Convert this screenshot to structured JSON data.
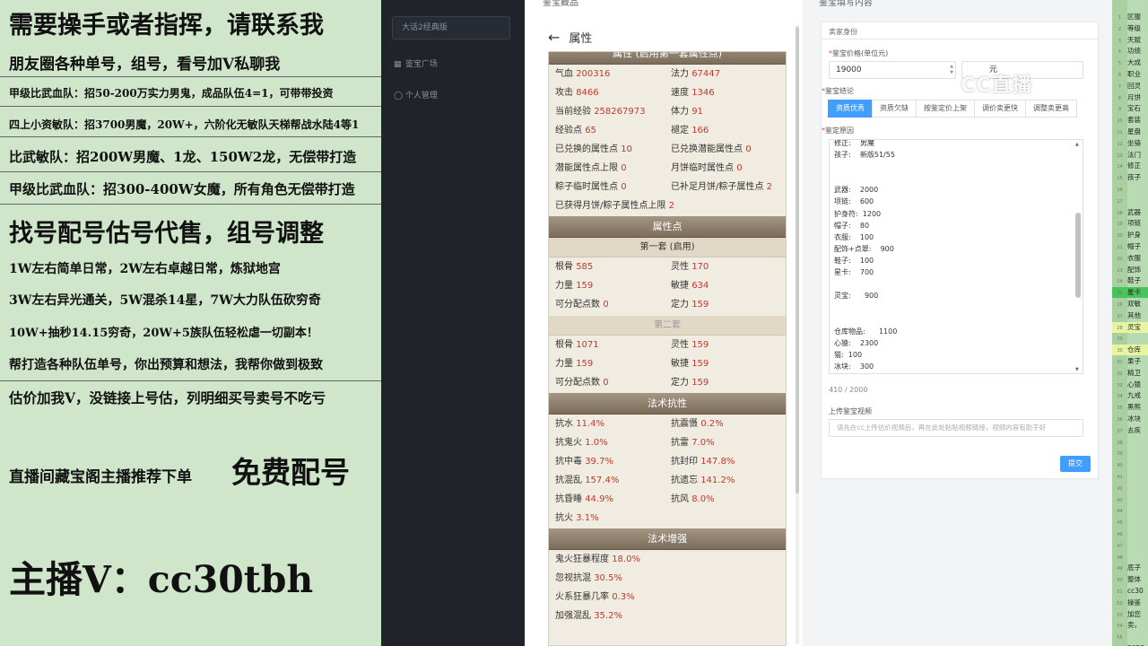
{
  "promo": {
    "lines": [
      "需要操手或者指挥，请联系我",
      "朋友圈各种单号，组号，看号加V私聊我",
      "甲级比武血队：招50-200万实力男鬼，成品队伍4=1，可带带投资",
      "四上小资敏队：招3700男魔，20W+，六阶化无敏队天梯帮战水陆4等1",
      "比武敏队：招200W男魔、1龙、150W2龙，无偿带打造",
      "甲级比武血队：招300-400W女魔，所有角色无偿带打造",
      "找号配号估号代售，组号调整",
      "1W左右简单日常，2W左右卓越日常，炼狱地宫",
      "3W左右异光通关，5W混杀14星，7W大力队伍砍穷奇",
      "10W+抽秒14.15穷奇，20W+5族队伍轻松虐一切副本！",
      "帮打造各种队伍单号，你出预算和想法，我帮你做到极致",
      "估价加我V，没链接上号估，列明细买号卖号不吃亏",
      "直播间藏宝阁主播推荐下单",
      "免费配号",
      "主播V：cc30tbh"
    ]
  },
  "nav": {
    "server_select": "大话2经典版",
    "items": [
      "鉴宝广场",
      "个人管理"
    ]
  },
  "attr_panel": {
    "top_text": "鉴宝藏品",
    "back_label": "属性",
    "section_basic_title": "属性 (启用第一套属性点)",
    "basic_rows": [
      [
        "气血",
        "200316",
        "法力",
        "67447"
      ],
      [
        "攻击",
        "8466",
        "速度",
        "1346"
      ],
      [
        "当前经验",
        "258267973",
        "体力",
        "91"
      ],
      [
        "经验点",
        "65",
        "褪定",
        "166"
      ],
      [
        "已兑换的属性点",
        "10",
        "已兑换潜能属性点",
        "0"
      ],
      [
        "潜能属性点上限",
        "0",
        "月饼临时属性点",
        "0"
      ],
      [
        "粽子临时属性点",
        "0",
        "已补足月饼/粽子属性点",
        "2"
      ]
    ],
    "basic_full_row": [
      "已获得月饼/粽子属性点上限",
      "2"
    ],
    "section_points_title": "属性点",
    "set1_title": "第一套 (启用)",
    "set1_rows": [
      [
        "根骨",
        "585",
        "灵性",
        "170"
      ],
      [
        "力量",
        "159",
        "敏捷",
        "634"
      ],
      [
        "可分配点数",
        "0",
        "定力",
        "159"
      ]
    ],
    "set2_title": "第二套",
    "set2_rows": [
      [
        "根骨",
        "1071",
        "灵性",
        "159"
      ],
      [
        "力量",
        "159",
        "敏捷",
        "159"
      ],
      [
        "可分配点数",
        "0",
        "定力",
        "159"
      ]
    ],
    "section_resist_title": "法术抗性",
    "resist_rows": [
      [
        "抗水",
        "11.4%",
        "抗震慑",
        "0.2%"
      ],
      [
        "抗鬼火",
        "1.0%",
        "抗雷",
        "7.0%"
      ],
      [
        "抗中毒",
        "39.7%",
        "抗封印",
        "147.8%"
      ],
      [
        "抗混乱",
        "157.4%",
        "抗遗忘",
        "141.2%"
      ],
      [
        "抗昏睡",
        "44.9%",
        "抗风",
        "8.0%"
      ]
    ],
    "resist_full_row": [
      "抗火",
      "3.1%"
    ],
    "section_boost_title": "法术增强",
    "boost_rows": [
      [
        "鬼火狂暴程度",
        "18.0%"
      ],
      [
        "忽视抗混",
        "30.5%"
      ],
      [
        "火系狂暴几率",
        "0.3%"
      ],
      [
        "加强混乱",
        "35.2%"
      ]
    ]
  },
  "form": {
    "top_text": "鉴宝填写内容",
    "card_title": "卖家身份",
    "price_label": "鉴宝价格(单位元)",
    "price_value": "19000",
    "unit_value": "元",
    "watermark": "CC直播",
    "conclusion_label": "鉴宝结论",
    "conclusion_tabs": [
      "资质优秀",
      "资质欠缺",
      "按鉴定价上架",
      "调价卖更快",
      "调整卖更高"
    ],
    "conclusion_selected": "资质优秀",
    "reason_label": "鉴定原因",
    "reason_text": "修正:    男魔\n孩子:    新版51/55\n\n\n武器:    2000\n项链:    600\n护身符:  1200\n帽子:    80\n衣服:    100\n配饰+点翠:    900\n鞋子:    100\n星卡:    700\n\n灵宝:      900\n\n\n仓库物品:      1100\n心猿:    2300\n猫:  100\n冰块:    300",
    "count_text": "410 / 2000",
    "video_label": "上传鉴宝视频",
    "video_placeholder": "请先在cc上传估价视频后，再在此处粘贴视频链接，视频内容有助于好",
    "submit_label": "提交"
  },
  "strip": {
    "lines": [
      "区服",
      "等级",
      "天赋",
      "功绩",
      "大成",
      "职业",
      "回灵",
      "月饼",
      "宝石",
      "套装",
      "星盘",
      "坐骑",
      "法门",
      "修正",
      "孩子",
      "",
      "",
      "武器",
      "项链",
      "护身",
      "帽子",
      "衣服",
      "配饰",
      "鞋子",
      "星卡",
      "双敏",
      "其他",
      "灵宝",
      "",
      "仓库",
      "果子",
      "精卫",
      "心猿",
      "九戒",
      "黑熊",
      "冰块",
      "去疾",
      "",
      "",
      "",
      "",
      "",
      "",
      "",
      "",
      "",
      "",
      "",
      "底子",
      "整体",
      "cc30",
      "操鉴",
      "加您",
      "卖，",
      "",
      "2023"
    ]
  }
}
